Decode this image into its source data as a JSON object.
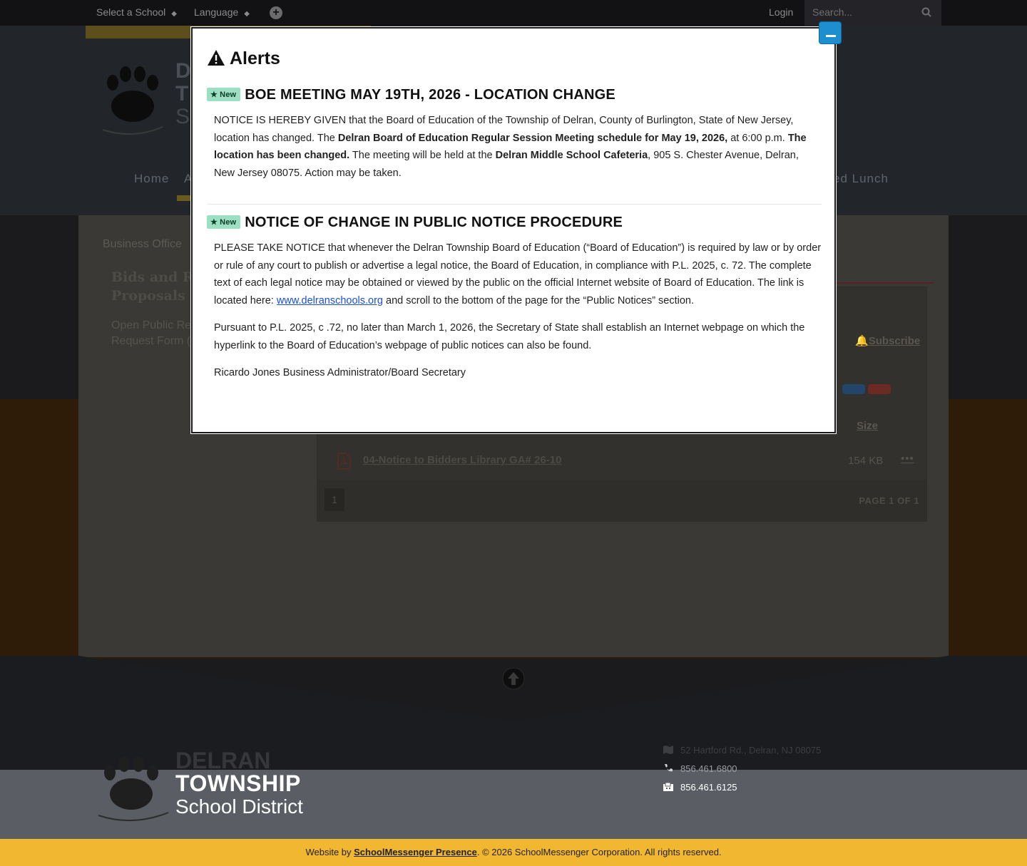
{
  "topbar": {
    "select_school": "Select a School",
    "language": "Language",
    "login": "Login",
    "search_placeholder": "Search..."
  },
  "header": {
    "letters": [
      "D",
      "T",
      "S"
    ],
    "nav": [
      "Home",
      "A",
      "ed Lunch"
    ]
  },
  "content": {
    "breadcrumb": "Business Office",
    "heading_lines": [
      "Bids and Re",
      "Proposals"
    ],
    "side_lines": [
      "Open Public Re",
      "Request Form ("
    ],
    "subscribe": "Subscribe",
    "size_header": "Size",
    "file_name": "04-Notice to Bidders Library GA# 26-10",
    "file_size": "154 KB",
    "more": "•••",
    "pager_num": "1",
    "pager_label": "PAGE 1 OF 1"
  },
  "modal": {
    "title": "Alerts",
    "alerts": [
      {
        "badge": "New",
        "heading": "BOE MEETING MAY 19TH, 2026 - LOCATION CHANGE",
        "body": [
          [
            {
              "t": "NOTICE IS HEREBY GIVEN that the Board of Education of the Township of Delran, County of Burlington, State of New Jersey, location has changed. The "
            },
            {
              "t": "Delran Board of Education Regular Session Meeting schedule for May 19, 2026,",
              "b": true
            },
            {
              "t": " at 6:00 p.m. "
            },
            {
              "t": "The location has been changed.",
              "b": true
            },
            {
              "t": " The meeting will be held at the "
            },
            {
              "t": "Delran Middle School Cafeteria",
              "b": true
            },
            {
              "t": ", 905 S. Chester Avenue, Delran, New Jersey 08075. Action may be taken."
            }
          ]
        ]
      },
      {
        "badge": "New",
        "heading": "NOTICE OF CHANGE IN PUBLIC NOTICE PROCEDURE",
        "body": [
          [
            {
              "t": "PLEASE TAKE NOTICE that whenever the Delran Township Board of Education (“Board of Education”) is required by law or by order or rule of any court to publish or advertise a legal notice, the Board of Education, in compliance with P.L. 2025, c. 72. The complete text of each legal notice may be obtained or viewed by the public on the official Internet website of Board of Education. The link is located here: "
            },
            {
              "t": "www.delranschools.org",
              "a": true
            },
            {
              "t": " and scroll to the bottom of the page for the “Public Notices” section."
            }
          ],
          [
            {
              "t": "Pursuant to P.L. 2025, c .72, no later than March 1, 2026, the Secretary of State shall establish an Internet webpage on which the hyperlink to the Board of Education’s webpage of public notices can also be found."
            }
          ],
          [
            {
              "t": "Ricardo Jones Business Administrator/Board Secretary"
            }
          ]
        ]
      }
    ]
  },
  "footer": {
    "delran": "DELRAN",
    "township": "TOWNSHIP",
    "school_district": "School District",
    "address": "52 Hartford Rd., Delran, NJ 08075",
    "phone": "856.461.6800",
    "fax": "856.461.6125",
    "credit_prefix": "Website by ",
    "credit_link": "SchoolMessenger Presence",
    "credit_suffix": ". © 2026 SchoolMessenger Corporation. All rights reserved."
  },
  "colors": {
    "close_button": "#1d8fd1",
    "badge_bg": "#9be0c1",
    "footer_bar": "#f2b731",
    "link": "#1a4fd6"
  }
}
